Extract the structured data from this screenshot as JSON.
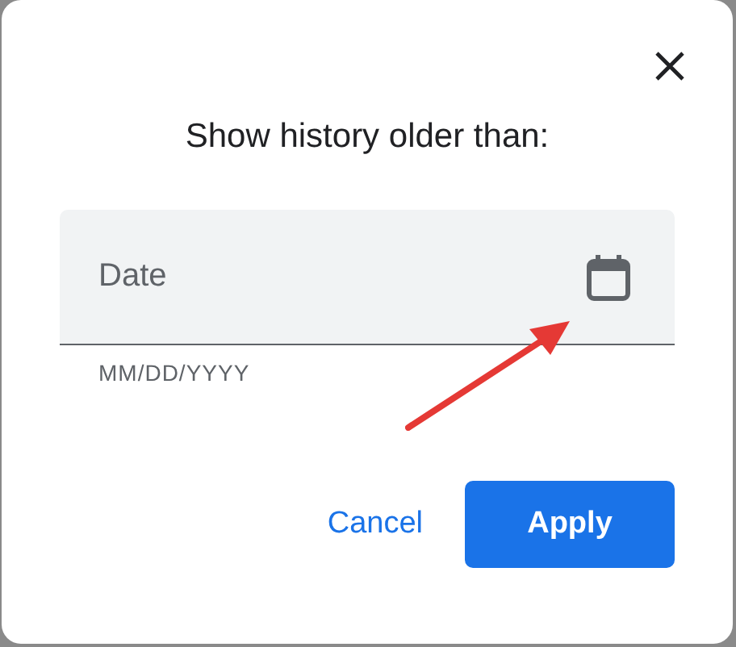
{
  "dialog": {
    "title": "Show history older than:"
  },
  "date_field": {
    "placeholder": "Date",
    "helper": "MM/DD/YYYY"
  },
  "buttons": [
    {
      "label": "Cancel",
      "kind": "text"
    },
    {
      "label": "Apply",
      "kind": "filled"
    }
  ]
}
